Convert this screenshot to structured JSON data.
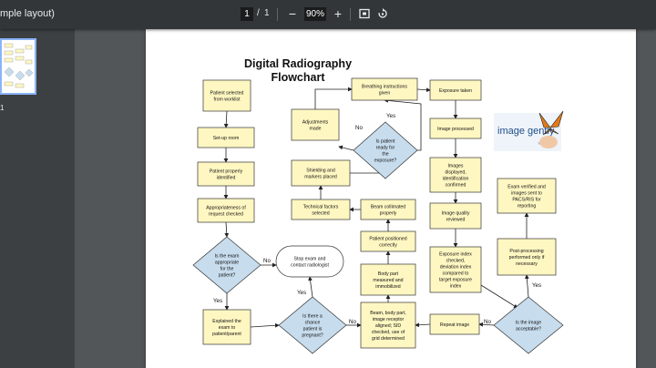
{
  "toolbar": {
    "doc_title": "mple layout)",
    "current_page": "1",
    "page_sep": "/",
    "total_pages": "1",
    "zoom_out": "−",
    "zoom": "90%",
    "zoom_in": "+"
  },
  "sidebar": {
    "thumb_number": "1"
  },
  "flowchart": {
    "title_line1": "Digital Radiography",
    "title_line2": "Flowchart",
    "logo_text": "image gently",
    "logo_tm": "™",
    "nodes": {
      "n1": [
        "Patient selected",
        "from worklist"
      ],
      "n2": [
        "Set-up room"
      ],
      "n3": [
        "Patient properly",
        "identified"
      ],
      "n4": [
        "Appropriateness of",
        "request checked"
      ],
      "d1": [
        "Is the exam",
        "appropriate",
        "for the",
        "patient?"
      ],
      "n5": [
        "Explained the",
        "exam to",
        "patient/parent"
      ],
      "stop": [
        "Stop exam and",
        "contact radiologist"
      ],
      "d2": [
        "Is there a",
        "chance",
        "patient is",
        "pregnant?"
      ],
      "n6": [
        "Beam, body part,",
        "image receptor",
        "aligned; SID",
        "checked, use of",
        "grid determined"
      ],
      "n7": [
        "Body part",
        "measured and",
        "immobilized"
      ],
      "n8": [
        "Patient positioned",
        "correctly"
      ],
      "n9": [
        "Beam collimated",
        "properly"
      ],
      "n10": [
        "Technical factors",
        "selected"
      ],
      "n11": [
        "Shielding and",
        "markers placed"
      ],
      "d3": [
        "Is patient",
        "ready for",
        "the",
        "exposure?"
      ],
      "n12": [
        "Adjustments",
        "made"
      ],
      "n13": [
        "Breathing instructions",
        "given"
      ],
      "n14": [
        "Exposure taken"
      ],
      "n15": [
        "Image processed"
      ],
      "n16": [
        "Images",
        "displayed,",
        "identification",
        "confirmed"
      ],
      "n17": [
        "Image quality",
        "reviewed"
      ],
      "n18": [
        "Exposure index",
        "checked,",
        "deviation index",
        "compared to",
        "target exposure",
        "index"
      ],
      "n19": [
        "Repeat image"
      ],
      "d4": [
        "Is the image",
        "acceptable?"
      ],
      "n20": [
        "Post-processing",
        "performed only if",
        "necessary"
      ],
      "n21": [
        "Exam verified and",
        "images sent to",
        "PACS/RIS for",
        "reporting"
      ]
    },
    "labels": {
      "d1_no": "No",
      "d1_yes": "Yes",
      "d2_yes": "Yes",
      "d2_no": "No",
      "d3_no": "No",
      "d3_yes": "Yes",
      "d4_no": "No",
      "d4_yes": "Yes"
    }
  },
  "colors": {
    "box_fill": "#fff7c2",
    "diamond_fill": "#c7dced",
    "accent": "#8ab4f8"
  }
}
